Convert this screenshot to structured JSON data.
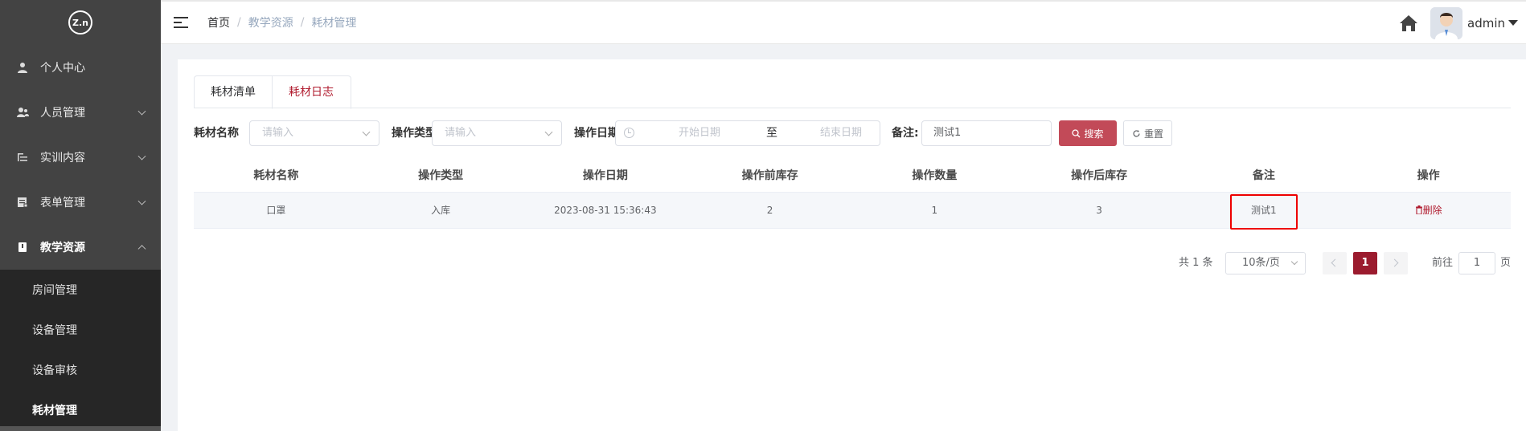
{
  "logo": {
    "text": "Z.n"
  },
  "sidebar": {
    "items": [
      {
        "label": "个人中心",
        "icon": "user-icon"
      },
      {
        "label": "人员管理",
        "icon": "users-icon"
      },
      {
        "label": "实训内容",
        "icon": "list-icon"
      },
      {
        "label": "表单管理",
        "icon": "form-icon"
      },
      {
        "label": "教学资源",
        "icon": "book-icon"
      }
    ],
    "submenu": [
      "房间管理",
      "设备管理",
      "设备审核",
      "耗材管理"
    ]
  },
  "header": {
    "breadcrumb": [
      "首页",
      "教学资源",
      "耗材管理"
    ],
    "username": "admin"
  },
  "tabs": [
    "耗材清单",
    "耗材日志"
  ],
  "filters": {
    "name_label": "耗材名称",
    "name_placeholder": "请输入",
    "type_label": "操作类型",
    "type_placeholder": "请输入",
    "date_label": "操作日期",
    "start_placeholder": "开始日期",
    "to": "至",
    "end_placeholder": "结束日期",
    "remark_label": "备注:",
    "remark_value": "测试1",
    "search_label": "搜索",
    "reset_label": "重置"
  },
  "table": {
    "headers": [
      "耗材名称",
      "操作类型",
      "操作日期",
      "操作前库存",
      "操作数量",
      "操作后库存",
      "备注",
      "操作"
    ],
    "rows": [
      {
        "name": "口罩",
        "type": "入库",
        "date": "2023-08-31 15:36:43",
        "before": "2",
        "qty": "1",
        "after": "3",
        "remark": "测试1",
        "action": "删除"
      }
    ]
  },
  "pagination": {
    "total": "共 1 条",
    "page_size": "10条/页",
    "current": "1",
    "goto_prefix": "前往",
    "goto_value": "1",
    "goto_suffix": "页"
  },
  "colors": {
    "sidebar_bg": "#434343",
    "submenu_bg": "#262626",
    "accent": "#9b1b2e",
    "search_btn": "#c24a58"
  }
}
